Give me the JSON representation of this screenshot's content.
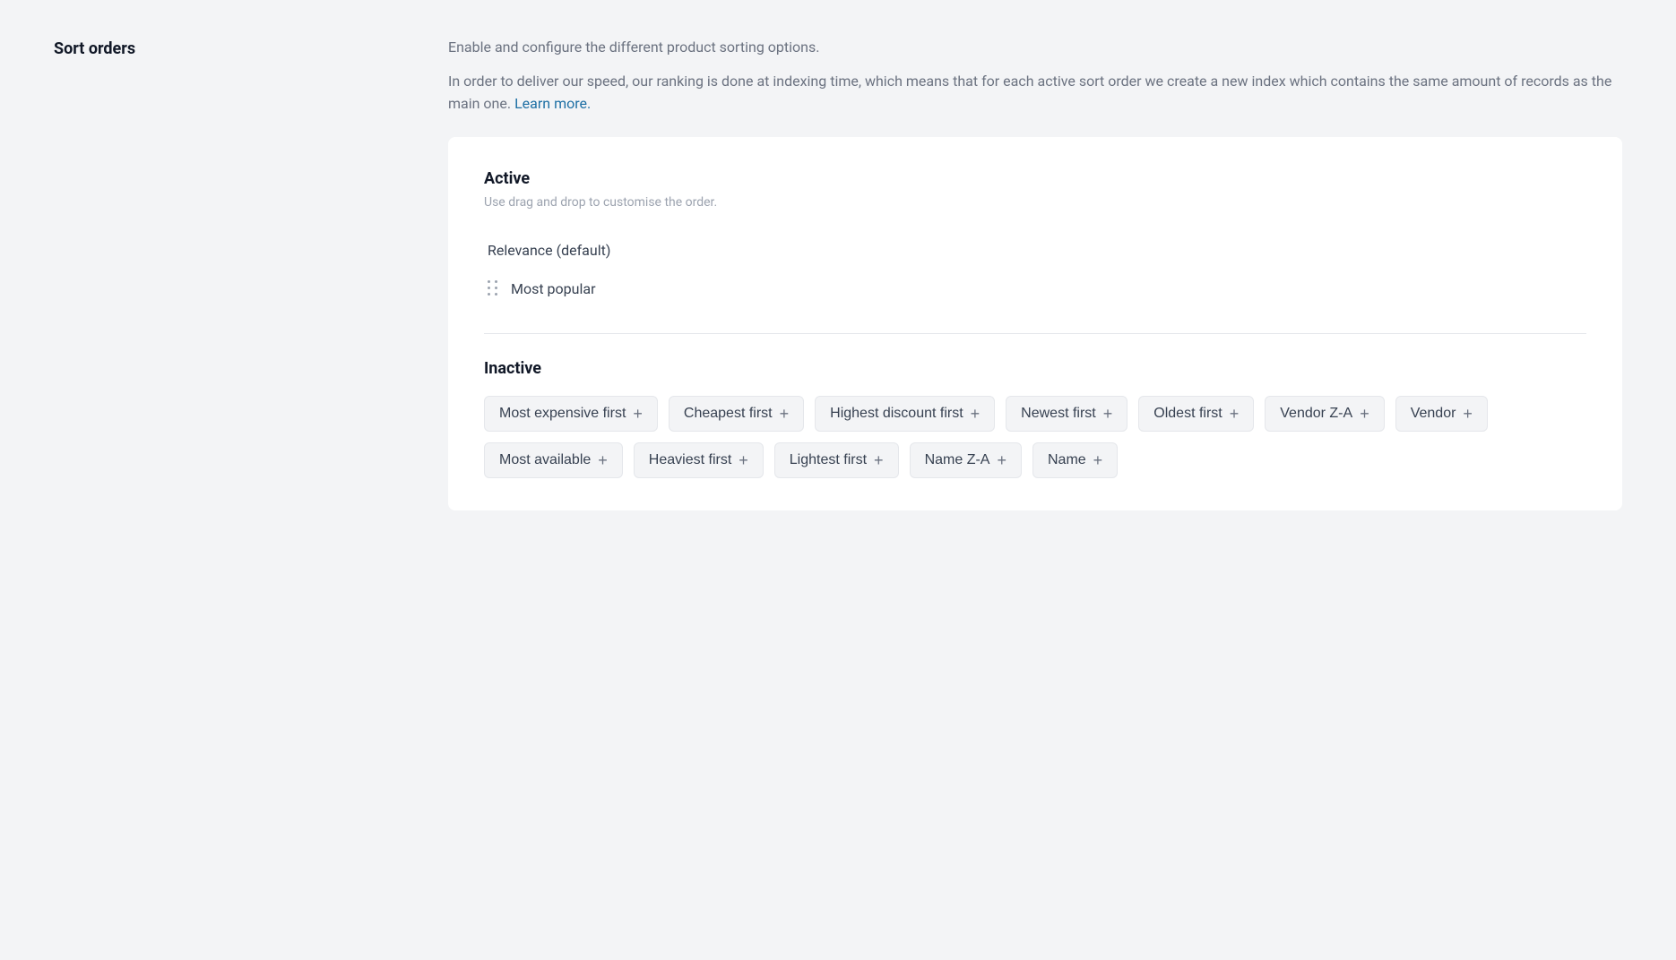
{
  "page": {
    "left": {
      "section_title": "Sort orders"
    },
    "right": {
      "description_line1": "Enable and configure the different product sorting options.",
      "description_line2": "In order to deliver our speed, our ranking is done at indexing time, which means that for each active sort order we create a new index which contains the same amount of records as the main one.",
      "learn_more_label": "Learn more.",
      "learn_more_href": "#",
      "active_section": {
        "label": "Active",
        "subtitle": "Use drag and drop to customise the order.",
        "items": [
          {
            "id": "relevance",
            "label": "Relevance (default)",
            "draggable": false
          },
          {
            "id": "most-popular",
            "label": "Most popular",
            "draggable": true
          }
        ]
      },
      "inactive_section": {
        "label": "Inactive",
        "tags": [
          {
            "id": "most-expensive-first",
            "label": "Most expensive first"
          },
          {
            "id": "cheapest-first",
            "label": "Cheapest first"
          },
          {
            "id": "highest-discount-first",
            "label": "Highest discount first"
          },
          {
            "id": "newest-first",
            "label": "Newest first"
          },
          {
            "id": "oldest-first",
            "label": "Oldest first"
          },
          {
            "id": "vendor-z-a",
            "label": "Vendor Z-A"
          },
          {
            "id": "vendor",
            "label": "Vendor"
          },
          {
            "id": "most-available",
            "label": "Most available"
          },
          {
            "id": "heaviest-first",
            "label": "Heaviest first"
          },
          {
            "id": "lightest-first",
            "label": "Lightest first"
          },
          {
            "id": "name-z-a",
            "label": "Name Z-A"
          },
          {
            "id": "name",
            "label": "Name"
          }
        ]
      }
    }
  }
}
